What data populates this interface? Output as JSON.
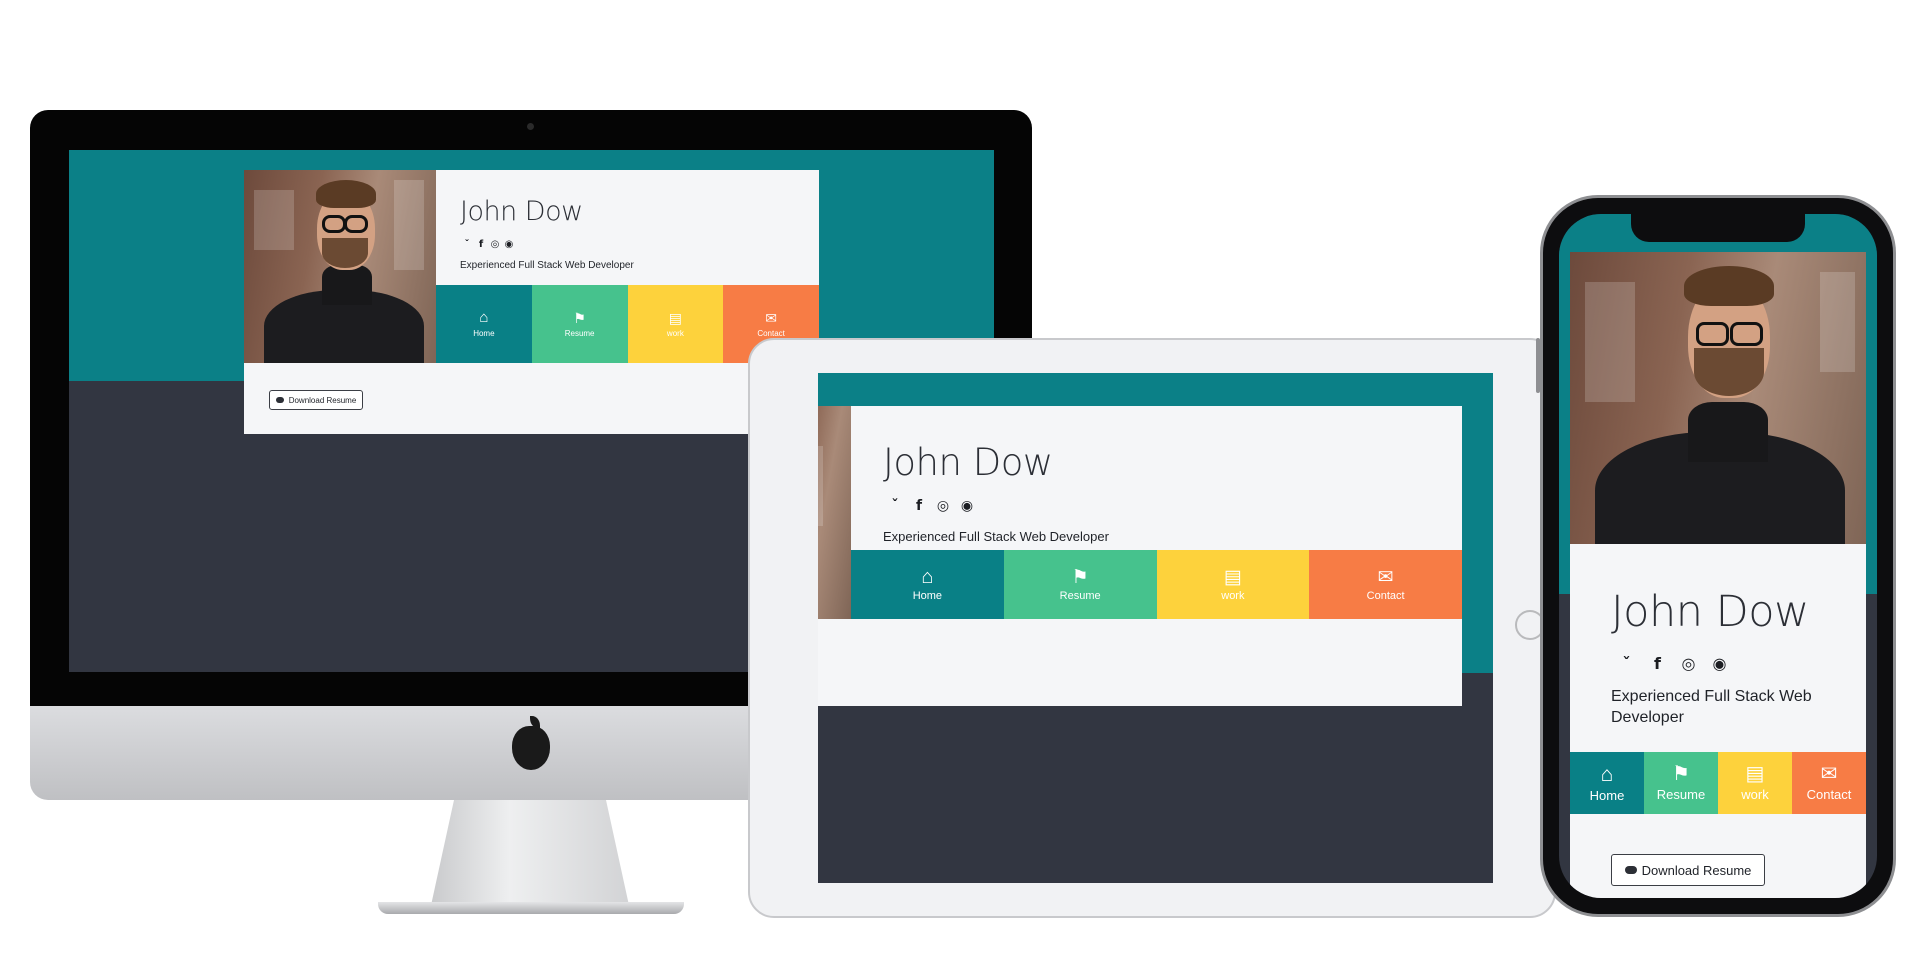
{
  "profile": {
    "name": "John Dow",
    "tagline": "Experienced Full Stack Web Developer",
    "tagline_mobile_line1": "Experienced Full Stack Web",
    "tagline_mobile_line2": "Developer",
    "download_label": "Download Resume"
  },
  "socials": [
    {
      "icon": "twitter-icon",
      "glyph": "ˇ"
    },
    {
      "icon": "facebook-icon",
      "glyph": "f"
    },
    {
      "icon": "instagram-icon",
      "glyph": "◎"
    },
    {
      "icon": "github-icon",
      "glyph": "◉"
    }
  ],
  "nav": [
    {
      "label": "Home",
      "icon": "home-icon",
      "glyph": "⌂",
      "color": "#098086"
    },
    {
      "label": "Resume",
      "icon": "graduation-cap-icon",
      "glyph": "⚑",
      "color": "#46c28d"
    },
    {
      "label": "work",
      "icon": "folder-open-icon",
      "glyph": "▤",
      "color": "#fdd23c"
    },
    {
      "label": "Contact",
      "icon": "envelope-icon",
      "glyph": "✉",
      "color": "#f77c45"
    }
  ],
  "colors": {
    "teal_header": "#0b8087",
    "dark_background": "#323641",
    "card": "#f5f6f8",
    "home": "#098086",
    "resume": "#46c28d",
    "work": "#fdd23c",
    "contact": "#f77c45"
  }
}
